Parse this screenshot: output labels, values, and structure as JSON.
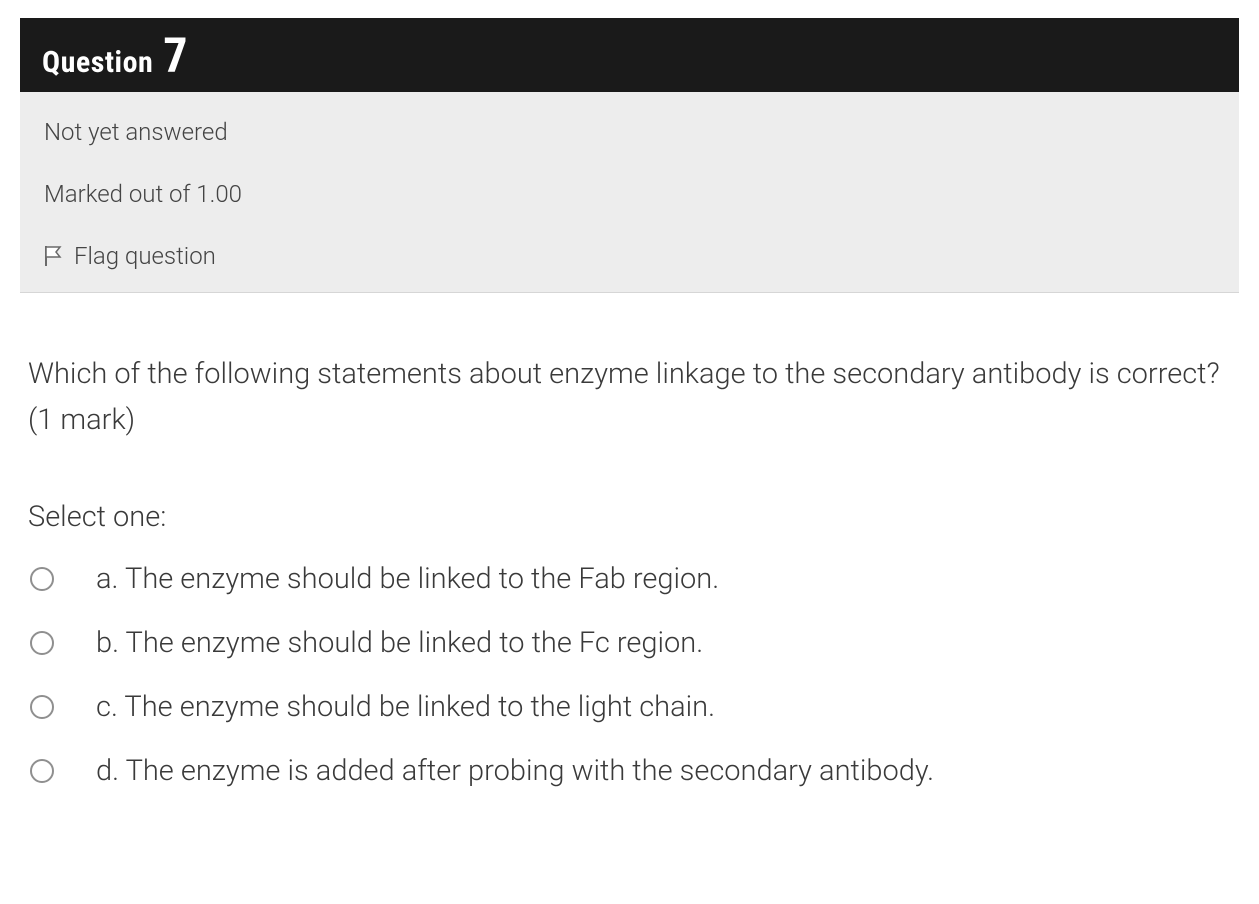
{
  "header": {
    "label": "Question",
    "number": "7"
  },
  "info": {
    "status": "Not yet answered",
    "marks": "Marked out of 1.00",
    "flag_label": "Flag question"
  },
  "question": {
    "text": "Which of the following statements about enzyme linkage to the secondary antibody is correct? (1 mark)",
    "select_label": "Select one:",
    "options": [
      {
        "letter": "a.",
        "text": "The enzyme should be linked to the Fab region."
      },
      {
        "letter": "b.",
        "text": "The enzyme should be linked to the Fc region."
      },
      {
        "letter": "c.",
        "text": "The enzyme should be linked to the light chain."
      },
      {
        "letter": "d.",
        "text": "The enzyme is added after probing with the secondary antibody."
      }
    ]
  }
}
